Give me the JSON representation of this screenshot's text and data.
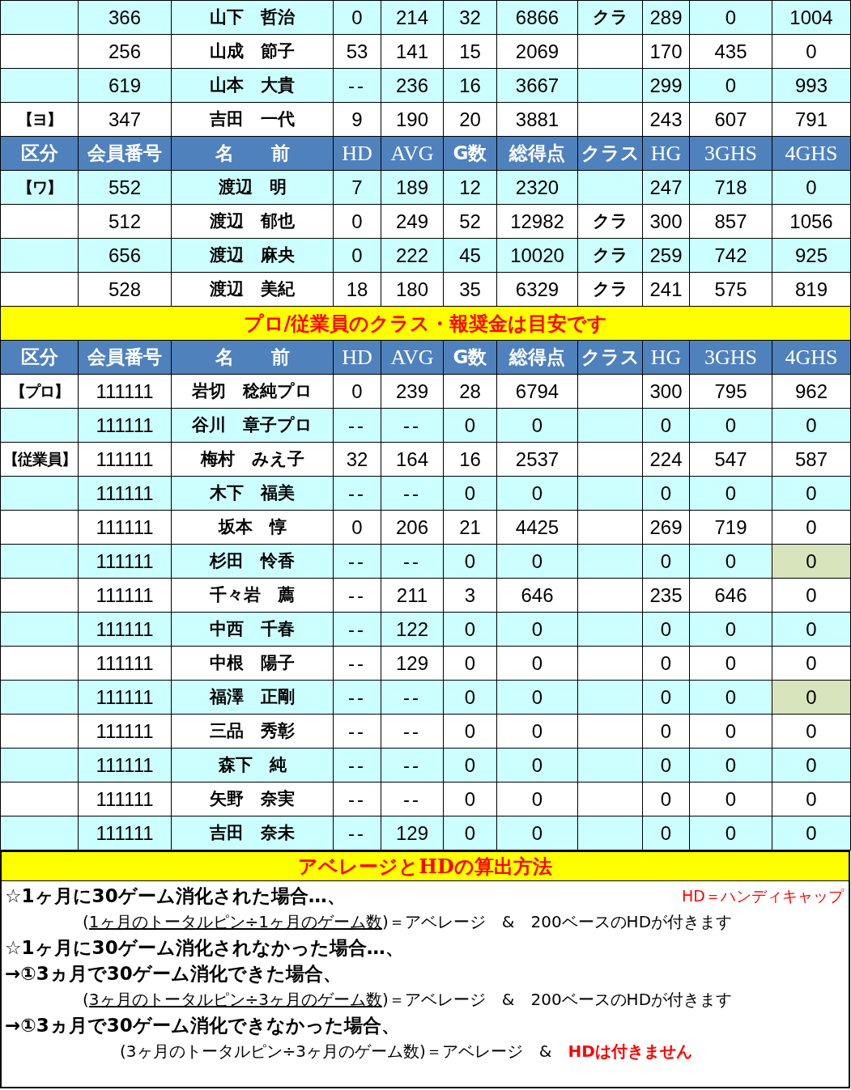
{
  "table": {
    "rows": [
      {
        "kind": "data",
        "shaded": true,
        "marked": false,
        "no": "366",
        "name": "山下　哲治",
        "hd": "0",
        "avg": "214",
        "g": "32",
        "total": "6866",
        "cls": "クラ",
        "hg": "289",
        "g3": "0",
        "g4": "1004"
      },
      {
        "kind": "data",
        "shaded": false,
        "marked": false,
        "no": "256",
        "name": "山成　節子",
        "hd": "53",
        "avg": "141",
        "g": "15",
        "total": "2069",
        "hg": "170",
        "g3": "435",
        "g4": "0"
      },
      {
        "kind": "data",
        "shaded": true,
        "marked": false,
        "no": "619",
        "name": "山本　大貴",
        "hd": "--",
        "avg": "236",
        "g": "16",
        "total": "3667",
        "hg": "299",
        "g3": "0",
        "g4": "993"
      },
      {
        "kind": "data",
        "shaded": false,
        "marked": false,
        "group": "【ヨ】",
        "no": "347",
        "name": "吉田　一代",
        "hd": "9",
        "avg": "190",
        "g": "20",
        "total": "3881",
        "hg": "243",
        "g3": "607",
        "g4": "791"
      },
      {
        "kind": "header",
        "cells": [
          "区分",
          "会員番号",
          "名　　前",
          "HD",
          "AVG",
          "G数",
          "総得点",
          "クラス",
          "HG",
          "3GHS",
          "4GHS"
        ]
      },
      {
        "kind": "data",
        "shaded": true,
        "marked": false,
        "group": "【ワ】",
        "no": "552",
        "name": "渡辺　明",
        "hd": "7",
        "avg": "189",
        "g": "12",
        "total": "2320",
        "hg": "247",
        "g3": "718",
        "g4": "0"
      },
      {
        "kind": "data",
        "shaded": false,
        "marked": false,
        "no": "512",
        "name": "渡辺　郁也",
        "hd": "0",
        "avg": "249",
        "g": "52",
        "total": "12982",
        "cls": "クラ",
        "hg": "300",
        "g3": "857",
        "g4": "1056"
      },
      {
        "kind": "data",
        "shaded": true,
        "marked": false,
        "no": "656",
        "name": "渡辺　麻央",
        "hd": "0",
        "avg": "222",
        "g": "45",
        "total": "10020",
        "cls": "クラ",
        "hg": "259",
        "g3": "742",
        "g4": "925"
      },
      {
        "kind": "data",
        "shaded": false,
        "marked": false,
        "no": "528",
        "name": "渡辺　美紀",
        "hd": "18",
        "avg": "180",
        "g": "35",
        "total": "6329",
        "cls": "クラ",
        "hg": "241",
        "g3": "575",
        "g4": "819"
      },
      {
        "kind": "banner",
        "text": "プロ/従業員のクラス・報奨金は目安です"
      },
      {
        "kind": "header",
        "cells": [
          "区分",
          "会員番号",
          "名　　前",
          "HD",
          "AVG",
          "G数",
          "総得点",
          "クラス",
          "HG",
          "3GHS",
          "4GHS"
        ]
      },
      {
        "kind": "data",
        "shaded": false,
        "marked": false,
        "group": "【プロ】",
        "no": "111111",
        "name": "岩切　稔純プロ",
        "hd": "0",
        "avg": "239",
        "g": "28",
        "total": "6794",
        "hg": "300",
        "g3": "795",
        "g4": "962"
      },
      {
        "kind": "data",
        "shaded": true,
        "marked": false,
        "no": "111111",
        "name": "谷川　章子プロ",
        "hd": "--",
        "avg": "--",
        "g": "0",
        "total": "0",
        "hg": "0",
        "g3": "0",
        "g4": "0"
      },
      {
        "kind": "data",
        "shaded": false,
        "marked": false,
        "group": "【従業員】",
        "no": "111111",
        "name": "梅村　みえ子",
        "hd": "32",
        "avg": "164",
        "g": "16",
        "total": "2537",
        "hg": "224",
        "g3": "547",
        "g4": "587"
      },
      {
        "kind": "data",
        "shaded": true,
        "marked": false,
        "no": "111111",
        "name": "木下　福美",
        "hd": "--",
        "avg": "--",
        "g": "0",
        "total": "0",
        "hg": "0",
        "g3": "0",
        "g4": "0"
      },
      {
        "kind": "data",
        "shaded": false,
        "marked": false,
        "no": "111111",
        "name": "坂本　惇",
        "hd": "0",
        "avg": "206",
        "g": "21",
        "total": "4425",
        "hg": "269",
        "g3": "719",
        "g4": "0"
      },
      {
        "kind": "data",
        "shaded": true,
        "marked": true,
        "no": "111111",
        "name": "杉田　怜香",
        "hd": "--",
        "avg": "--",
        "g": "0",
        "total": "0",
        "hg": "0",
        "g3": "0",
        "g4": "0"
      },
      {
        "kind": "data",
        "shaded": false,
        "marked": false,
        "no": "111111",
        "name": "千々岩　薦",
        "hd": "--",
        "avg": "211",
        "g": "3",
        "total": "646",
        "hg": "235",
        "g3": "646",
        "g4": "0"
      },
      {
        "kind": "data",
        "shaded": true,
        "marked": false,
        "no": "111111",
        "name": "中西　千春",
        "hd": "--",
        "avg": "122",
        "g": "0",
        "total": "0",
        "hg": "0",
        "g3": "0",
        "g4": "0"
      },
      {
        "kind": "data",
        "shaded": false,
        "marked": false,
        "no": "111111",
        "name": "中根　陽子",
        "hd": "--",
        "avg": "129",
        "g": "0",
        "total": "0",
        "hg": "0",
        "g3": "0",
        "g4": "0"
      },
      {
        "kind": "data",
        "shaded": true,
        "marked": true,
        "no": "111111",
        "name": "福澤　正剛",
        "hd": "--",
        "avg": "--",
        "g": "0",
        "total": "0",
        "hg": "0",
        "g3": "0",
        "g4": "0"
      },
      {
        "kind": "data",
        "shaded": false,
        "marked": false,
        "no": "111111",
        "name": "三品　秀彰",
        "hd": "--",
        "avg": "--",
        "g": "0",
        "total": "0",
        "hg": "0",
        "g3": "0",
        "g4": "0"
      },
      {
        "kind": "data",
        "shaded": true,
        "marked": false,
        "no": "111111",
        "name": "森下　純",
        "hd": "--",
        "avg": "--",
        "g": "0",
        "total": "0",
        "hg": "0",
        "g3": "0",
        "g4": "0"
      },
      {
        "kind": "data",
        "shaded": false,
        "marked": false,
        "no": "111111",
        "name": "矢野　奈実",
        "hd": "--",
        "avg": "--",
        "g": "0",
        "total": "0",
        "hg": "0",
        "g3": "0",
        "g4": "0"
      },
      {
        "kind": "data",
        "shaded": true,
        "marked": false,
        "no": "111111",
        "name": "吉田　奈未",
        "hd": "--",
        "avg": "129",
        "g": "0",
        "total": "0",
        "hg": "0",
        "g3": "0",
        "g4": "0"
      }
    ]
  },
  "notes": {
    "title": "アベレージとHDの算出方法",
    "lines": [
      {
        "kind": "case",
        "segments": [
          {
            "kind": "plain",
            "text": "☆1ヶ月に30ゲーム消化された場合…、"
          }
        ],
        "aside": "HD＝ハンディキャップ"
      },
      {
        "kind": "formula",
        "segments": [
          {
            "kind": "plain",
            "text": "("
          },
          {
            "kind": "underline",
            "text": "1ヶ月のトータルピン÷1ヶ月のゲーム数"
          },
          {
            "kind": "plain",
            "text": ")＝アベレージ　&　200ベースのHDが付きます"
          }
        ]
      },
      {
        "kind": "case",
        "segments": [
          {
            "kind": "plain",
            "text": "☆1ヶ月に30ゲーム消化されなかった場合…、"
          }
        ]
      },
      {
        "kind": "case",
        "segments": [
          {
            "kind": "plain",
            "text": "→①3ヵ月で30ゲーム消化できた場合、"
          }
        ]
      },
      {
        "kind": "formula",
        "segments": [
          {
            "kind": "plain",
            "text": "("
          },
          {
            "kind": "underline",
            "text": "3ヶ月のトータルピン÷3ヶ月のゲーム数"
          },
          {
            "kind": "plain",
            "text": ")＝アベレージ　&　200ベースのHDが付きます"
          }
        ]
      },
      {
        "kind": "case",
        "segments": [
          {
            "kind": "plain",
            "text": "→①3ヵ月で30ゲーム消化できなかった場合、"
          }
        ]
      },
      {
        "kind": "formula_wide",
        "segments": [
          {
            "kind": "plain",
            "text": "(3ヶ月のトータルピン÷3ヶ月のゲーム数)＝アベレージ　&　"
          },
          {
            "kind": "red",
            "text": "HDは付きません"
          }
        ]
      }
    ]
  }
}
